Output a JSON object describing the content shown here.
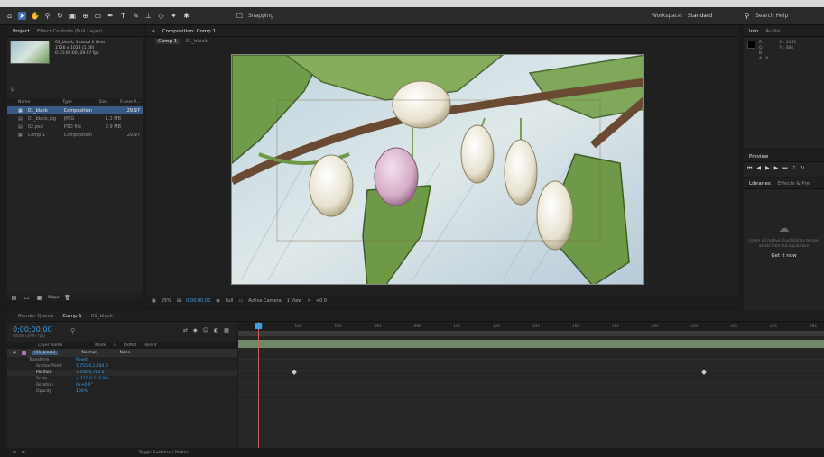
{
  "toolbar": {
    "snapping_label": "Snapping",
    "workspace_label": "Workspace:",
    "workspace_value": "Standard",
    "search_help_label": "Search Help"
  },
  "project_panel": {
    "tabs": [
      "Project",
      "Effect Controls (Full Layer)"
    ],
    "info_lines": [
      "01_black, 1 usual 1 time",
      "1726 x 1028 (1.00)",
      "0:15:00:00, 29.97 fps"
    ],
    "columns": [
      "Name",
      "Type",
      "Size",
      "Frame R..."
    ],
    "items": [
      {
        "name": "01_black",
        "type": "Composition",
        "size": "",
        "rate": "29.97",
        "selected": true
      },
      {
        "name": "01_black.jpg",
        "type": "JPEG",
        "size": "1.1 MB",
        "rate": "",
        "selected": false
      },
      {
        "name": "02.psd",
        "type": "PSD file",
        "size": "2.9 MB",
        "rate": "",
        "selected": false
      },
      {
        "name": "Comp 1",
        "type": "Composition",
        "size": "",
        "rate": "29.97",
        "selected": false
      }
    ],
    "footer_label": "8 bpc"
  },
  "composition_panel": {
    "tab_label": "Composition: Comp 1",
    "sub_tab_label": "Comp 1",
    "sub_tab2_label": "01_black",
    "zoom_label": "25%",
    "timecode": "0;00;00;00",
    "resolution": "Full",
    "camera": "Active Camera",
    "views": "1 View",
    "offset": "+0.0"
  },
  "info_panel": {
    "tabs": [
      "Info",
      "Audio"
    ],
    "lines": [
      "R :",
      "G :",
      "B :",
      "A : 0"
    ],
    "coords": [
      "X : 1181",
      "Y : 484"
    ]
  },
  "preview_panel": {
    "title": "Preview"
  },
  "libraries_panel": {
    "tabs": [
      "Libraries",
      "Effects & Pre"
    ],
    "message": "Create a Creative Cloud Library to save assets from this application",
    "button_label": "Get it now"
  },
  "timeline": {
    "tabs": [
      "Render Queue",
      "Comp 1",
      "01_black"
    ],
    "timecode": "0;00;00;00",
    "fps_label": "00000 (29.97 fps)",
    "layer_columns": [
      "Layer Name",
      "Mode",
      "T",
      "TrkMat",
      "Parent"
    ],
    "layer": {
      "name": "[01_black]",
      "mode": "Normal",
      "parent": "None"
    },
    "properties": [
      {
        "name": "Transform",
        "value": "Reset"
      },
      {
        "name": "Anchor Point",
        "value": "1,755.0,1,484.0"
      },
      {
        "name": "Position",
        "value": "1,456.0,782.0"
      },
      {
        "name": "Scale",
        "value": "∞ 110.0,110.0%"
      },
      {
        "name": "Rotation",
        "value": "0x+0.0°"
      },
      {
        "name": "Opacity",
        "value": "100%"
      }
    ],
    "ruler_ticks": [
      "0s",
      "02s",
      "04s",
      "06s",
      "08s",
      "10s",
      "12s",
      "14s",
      "16s",
      "18s",
      "20s",
      "22s",
      "24s",
      "26s",
      "28s"
    ],
    "footer_label": "Toggle Switches / Modes"
  },
  "colors": {
    "accent": "#3d6fb2",
    "timecode_blue": "#3aa0e8",
    "playhead": "#d06060",
    "track_green": "#6f8a66"
  }
}
